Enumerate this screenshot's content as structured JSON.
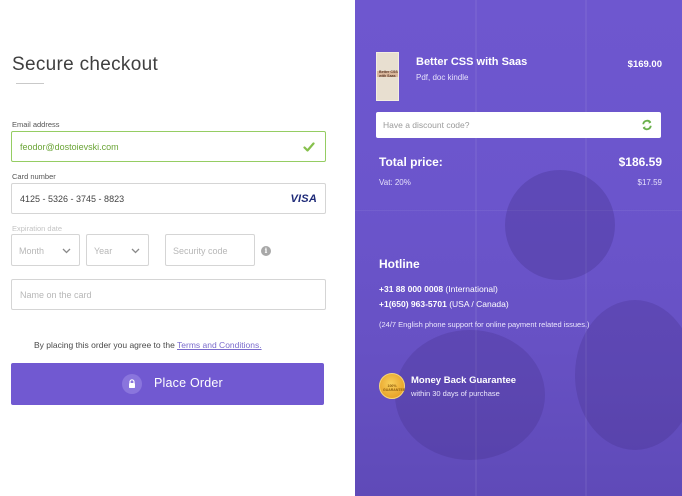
{
  "checkout": {
    "title": "Secure checkout",
    "email": {
      "label": "Email address",
      "value": "feodor@dostoievski.com",
      "status": "valid"
    },
    "card": {
      "label": "Card number",
      "value": "4125 - 5326 - 3745 - 8823",
      "brand": "VISA"
    },
    "expiration": {
      "label": "Expiration date",
      "month_placeholder": "Month",
      "year_placeholder": "Year",
      "security_placeholder": "Security code"
    },
    "name_placeholder": "Name on the card",
    "terms_text": "By placing this order you agree to the ",
    "terms_link": "Terms and Conditions.",
    "place_order_label": "Place Order",
    "accent_color": "#7159d1"
  },
  "summary": {
    "product": {
      "title": "Better CSS with Saas",
      "subtitle": "Pdf, doc kindle",
      "price": "$169.00",
      "cover_text": "Better CSS with Saas"
    },
    "discount_placeholder": "Have a discount code?",
    "total_label": "Total price:",
    "total_value": "$186.59",
    "vat_label": "Vat: 20%",
    "vat_value": "$17.59",
    "hotline": {
      "title": "Hotline",
      "phone_intl_number": "+31 88 000 0008",
      "phone_intl_region": " (International)",
      "phone_us_number": "+1(650) 963-5701",
      "phone_us_region": " (USA / Canada)",
      "support_note": "(24/7 English phone support for online payment related issues.)"
    },
    "guarantee": {
      "title": "Money Back Guarantee",
      "subtitle": "within 30 days of purchase",
      "badge_text": "100% GUARANTEE"
    },
    "background_color": "#6b55cc"
  }
}
